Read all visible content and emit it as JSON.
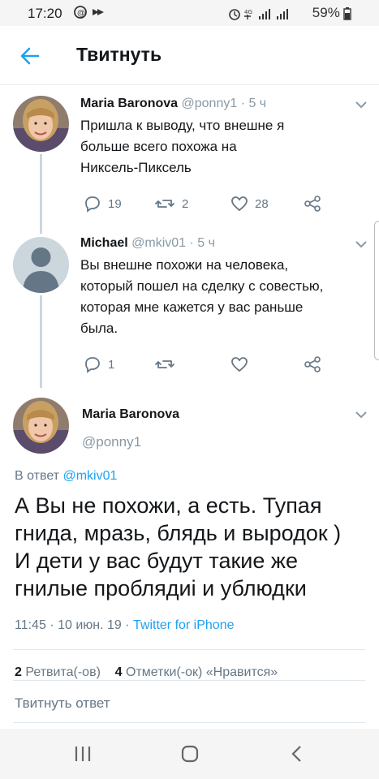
{
  "status_bar": {
    "time": "17:20",
    "battery": "59%"
  },
  "header": {
    "title": "Твитнуть"
  },
  "tweets": [
    {
      "name": "Maria Baronova",
      "handle": "@ponny1",
      "time": "· 5 ч",
      "lines": [
        "Пришла к выводу, что внешне я",
        "больше всего похожа на",
        "Никсель-Пиксель"
      ],
      "replies": "19",
      "retweets": "2",
      "likes": "28"
    },
    {
      "name": "Michael",
      "handle": "@mkiv01",
      "time": "· 5 ч",
      "lines": [
        "Вы внешне похожи на человека,",
        "который пошел на сделку с совестью,",
        "которая мне кажется у вас раньше",
        "была."
      ],
      "replies": "1"
    }
  ],
  "main_tweet": {
    "name": "Maria Baronova",
    "handle": "@ponny1",
    "reply_prefix": "В ответ",
    "reply_to": "@mkiv01",
    "lines": [
      "А Вы не похожи, а есть. Тупая",
      "гнида, мразь, блядь и выродок )",
      "И дети у вас будут такие же",
      "гнилые проблядиi и ублюдки"
    ],
    "timestamp": "11:45 · 10 июн. 19 ·",
    "source": "Twitter for iPhone",
    "retweets_count": "2",
    "retweets_label": "Ретвита(-ов)",
    "likes_count": "4",
    "likes_label": "Отметки(-ок) «Нравится»"
  },
  "reply_box": {
    "placeholder": "Твитнуть ответ"
  },
  "colors": {
    "accent": "#1da1f2",
    "thread_line": "#ccd6dd"
  },
  "icons": [
    "back-arrow-icon",
    "reply-icon",
    "retweet-icon",
    "like-icon",
    "share-icon",
    "chevron-down-icon",
    "recent-apps-icon",
    "home-icon",
    "nav-back-icon"
  ]
}
